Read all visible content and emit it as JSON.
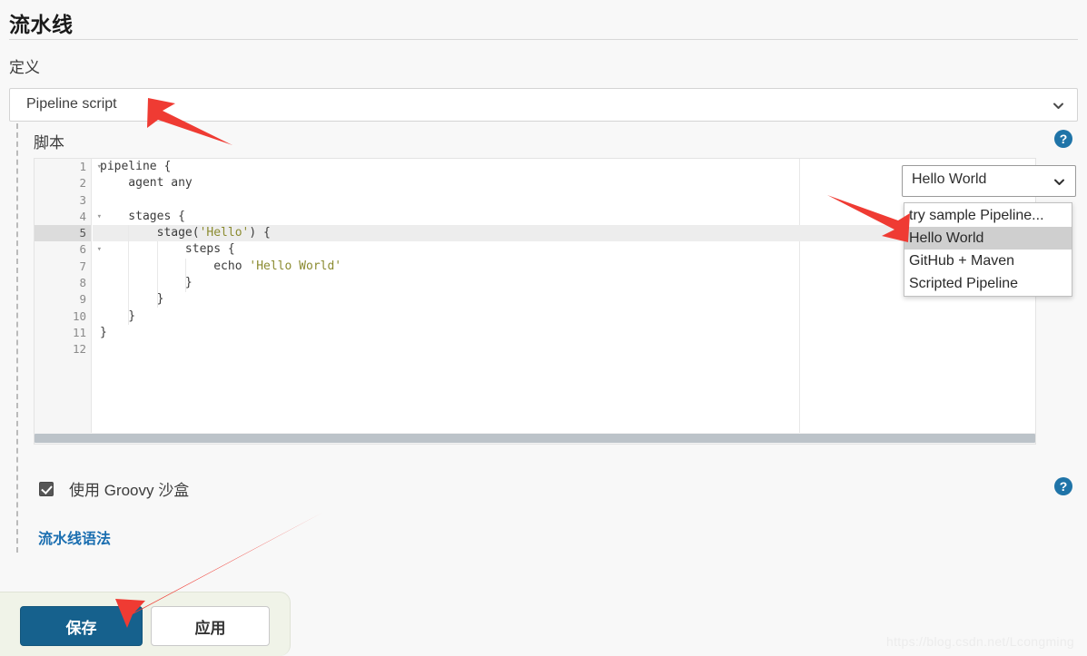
{
  "page": {
    "title": "流水线",
    "watermark": "https://blog.csdn.net/Lcongming"
  },
  "definition": {
    "label": "定义",
    "selected": "Pipeline script",
    "chevron_icon": "chevron-down-icon"
  },
  "script_section": {
    "label": "脚本",
    "help_icon": "help-circle-icon",
    "help_label": "?",
    "editor": {
      "active_line": 5,
      "line_numbers": [
        "1",
        "2",
        "3",
        "4",
        "5",
        "6",
        "7",
        "8",
        "9",
        "10",
        "11",
        "12"
      ],
      "fold_lines": [
        1,
        4,
        5,
        6
      ],
      "fold_glyph": "▾",
      "lines": [
        "pipeline {",
        "    agent any",
        "",
        "    stages {",
        "        stage('Hello') {",
        "            steps {",
        "                echo 'Hello World'",
        "            }",
        "        }",
        "    }",
        "}",
        ""
      ],
      "code_text": "pipeline {\n    agent any\n\n    stages {\n        stage('Hello') {\n            steps {\n                echo 'Hello World'\n            }\n        }\n    }\n}\n"
    }
  },
  "sample_dropdown": {
    "selected": "Hello World",
    "chevron_icon": "chevron-down-icon",
    "options": [
      "try sample Pipeline...",
      "Hello World",
      "GitHub + Maven",
      "Scripted Pipeline"
    ],
    "highlighted_index": 1
  },
  "sandbox": {
    "label": "使用 Groovy 沙盒",
    "checked": true,
    "checkbox_icon": "checkbox-checked-icon",
    "help_icon": "help-circle-icon",
    "help_label": "?"
  },
  "syntax_link": {
    "label": "流水线语法"
  },
  "buttons": {
    "save": "保存",
    "apply": "应用"
  },
  "annotations": {
    "arrow_color": "#ef3b33",
    "arrow_count": 3,
    "arrow_targets": [
      "definition-select",
      "sample-option-hello-world",
      "save-button"
    ]
  }
}
